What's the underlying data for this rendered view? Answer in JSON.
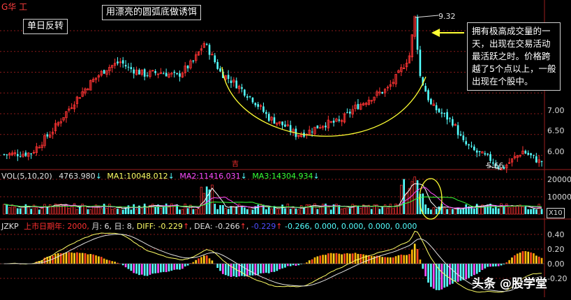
{
  "header": {
    "stock_name": "G华 工"
  },
  "annotations": {
    "single_day_reversal": "单日反转",
    "title": "用漂亮的圆弧底做诱饵",
    "volume_note": [
      "拥有极高成交量的一",
      "天，出现在交易活动",
      "最活跃之时。价格跨",
      "越了5个点以上，一般",
      "出现在个股中。"
    ],
    "high_label": "9.32",
    "low_label": "5.66",
    "ex_rights_mark": "吉"
  },
  "price_panel": {
    "y_ticks": [
      "7.00",
      "6.50",
      "6.00"
    ]
  },
  "volume_panel": {
    "legend": {
      "name": "VOL(5,10,20)",
      "vol": "4763.980",
      "ma1_label": "MA1:",
      "ma1": "10048.012",
      "ma2_label": "MA2:",
      "ma2": "11416.031",
      "ma3_label": "MA3:",
      "ma3": "14304.934",
      "arrow": "↓"
    },
    "y_ticks": [
      "20000",
      "10000"
    ],
    "unit": "X10"
  },
  "macd_panel": {
    "legend": {
      "name": "JZKP",
      "listing": "上市日期年: 2000,",
      "month": "月: 6,",
      "day": "日: 8,",
      "diff": "DIFF: -0.229",
      "dea": "DEA: -0.266",
      "v1": "-0.229",
      "v2": "-0.266,",
      "zeros": "0.000, 0.000, 0.000, 0.000",
      "up_arrow": "↑"
    },
    "y_ticks": [
      "0.40",
      "0.20",
      "0.00",
      "-0.20"
    ]
  },
  "watermark": "头条 @股学堂",
  "colors": {
    "up": "#ff3333",
    "down": "#54ffff",
    "ma1": "#ffffff",
    "ma2": "#ff4dff",
    "ma3": "#36ff36",
    "arc": "#ffff33",
    "grid": "#8b1a1a"
  },
  "chart_data": {
    "type": "candlestick",
    "y_axis": {
      "range": [
        5.5,
        9.5
      ],
      "ticks": [
        7.0,
        6.5,
        6.0
      ]
    },
    "price_path_anchors": [
      [
        0,
        6.02
      ],
      [
        10,
        6.05
      ],
      [
        18,
        6.6
      ],
      [
        26,
        7.3
      ],
      [
        32,
        7.75
      ],
      [
        38,
        8.1
      ],
      [
        43,
        8.25
      ],
      [
        46,
        8.1
      ],
      [
        52,
        7.95
      ],
      [
        58,
        8.0
      ],
      [
        64,
        7.9
      ],
      [
        70,
        8.25
      ],
      [
        74,
        8.7
      ],
      [
        76,
        8.5
      ],
      [
        80,
        8.0
      ],
      [
        86,
        7.7
      ],
      [
        92,
        7.35
      ],
      [
        98,
        6.9
      ],
      [
        104,
        6.7
      ],
      [
        108,
        6.5
      ],
      [
        112,
        6.55
      ],
      [
        118,
        6.75
      ],
      [
        124,
        6.8
      ],
      [
        130,
        7.15
      ],
      [
        136,
        7.4
      ],
      [
        142,
        7.6
      ],
      [
        146,
        7.95
      ],
      [
        150,
        8.4
      ],
      [
        152,
        9.32
      ],
      [
        154,
        7.9
      ],
      [
        158,
        7.2
      ],
      [
        166,
        6.8
      ],
      [
        170,
        6.3
      ],
      [
        174,
        6.1
      ],
      [
        180,
        5.9
      ],
      [
        184,
        5.66
      ],
      [
        192,
        6.1
      ],
      [
        198,
        5.85
      ]
    ],
    "high": 9.32,
    "low": 5.66,
    "volume": {
      "ticks": [
        20000,
        10000
      ],
      "latest": 4763.98,
      "ma1": 10048.012,
      "ma2": 11416.031,
      "ma3": 14304.934
    },
    "macd": {
      "ticks": [
        0.4,
        0.2,
        0.0,
        -0.2
      ],
      "diff": -0.229,
      "dea": -0.266
    }
  }
}
